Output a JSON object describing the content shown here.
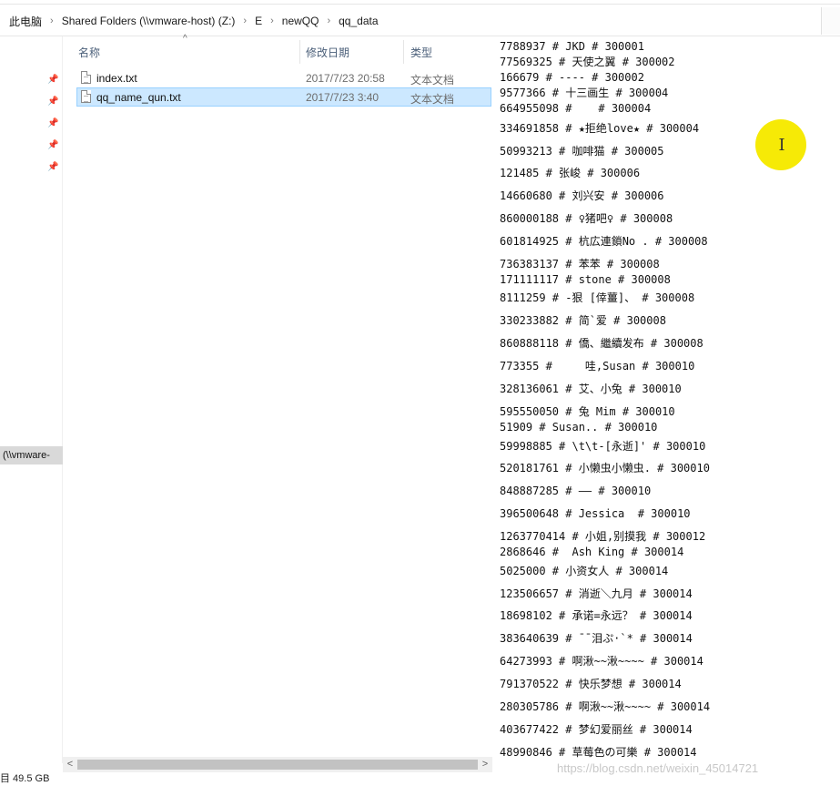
{
  "address_bar": {
    "crumbs": [
      "此电脑",
      "Shared Folders (\\\\vmware-host) (Z:)",
      "E",
      "newQQ",
      "qq_data"
    ],
    "separator": "›"
  },
  "nav_pane": {
    "pin_glyph": "📌",
    "vmware_item": "(\\\\vmware-"
  },
  "file_list": {
    "columns": {
      "name": "名称",
      "date": "修改日期",
      "type": "类型"
    },
    "sort_indicator": "^",
    "rows": [
      {
        "name": "index.txt",
        "date": "2017/7/23 20:58",
        "type": "文本文档",
        "selected": false
      },
      {
        "name": "qq_name_qun.txt",
        "date": "2017/7/23 3:40",
        "type": "文本文档",
        "selected": true
      }
    ]
  },
  "scrollbar": {
    "left_arrow": "<",
    "right_arrow": ">"
  },
  "status_bar": {
    "text": "目  49.5 GB"
  },
  "preview": {
    "lines": [
      "7788937 # JKD # 300001",
      "77569325 # 天使之翼 # 300002",
      "166679 # ---- # 300002",
      "9577366 # 十三画生 # 300004",
      "664955098 #    # 300004",
      "334691858 # ★拒绝love★ # 300004",
      "50993213 # 咖啡猫 # 300005",
      "121485 # 张峻 # 300006",
      "14660680 # 刘兴安 # 300006",
      "860000188 # ♀猪吧♀ # 300008",
      "601814925 # 杭広連鎖No . # 300008",
      "736383137 # 苯苯 # 300008",
      "171111117 # stone # 300008",
      "8111259 # -狠 [倖薑]、 # 300008",
      "330233882 # 简`爱 # 300008",
      "860888118 # 僑、繼續发布 # 300008",
      "773355 #     哇,Susan # 300010",
      "328136061 # 艾、小兔 # 300010",
      "595550050 # 兔 Mim # 300010",
      "51909 # Susan.. # 300010",
      "59998885 # \\t\\t-[永逝]' # 300010",
      "520181761 # 小懒虫小懒虫. # 300010",
      "848887285 # —— # 300010",
      "396500648 # Jessica  # 300010",
      "1263770414 # 小姐,别摸我 # 300012",
      "2868646 #  Ash King # 300014",
      "5025000 # 小资女人 # 300014",
      "123506657 # 消逝＼九月 # 300014",
      "18698102 # 承诺=永远？ # 300014",
      "383640639 # ¯¯泪ぷ·`* # 300014",
      "64273993 # 啊湫~~湫~~~~ # 300014",
      "791370522 # 快乐梦想 # 300014",
      "280305786 # 啊湫~~湫~~~~ # 300014",
      "403677422 # 梦幻爱丽丝 # 300014",
      "48990846 # 草莓色の可樂 # 300014"
    ],
    "cursor_glyph": "I",
    "watermark": "https://blog.csdn.net/weixin_45014721"
  }
}
